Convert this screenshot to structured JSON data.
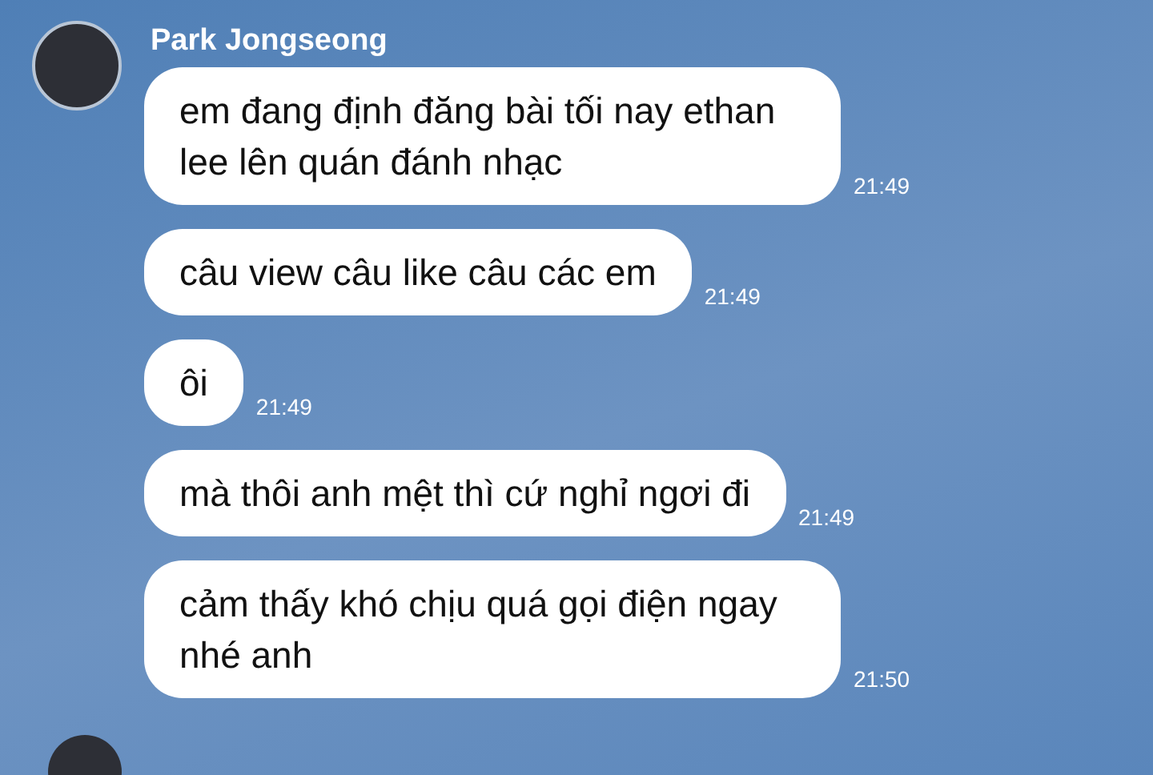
{
  "sender": {
    "name": "Park Jongseong"
  },
  "messages": [
    {
      "text": "em đang định đăng bài tối nay ethan lee lên quán đánh nhạc",
      "time": "21:49"
    },
    {
      "text": "câu view câu like câu các em",
      "time": "21:49"
    },
    {
      "text": "ôi",
      "time": "21:49"
    },
    {
      "text": "mà thôi anh mệt thì cứ nghỉ ngơi đi",
      "time": "21:49"
    },
    {
      "text": "cảm thấy khó chịu quá gọi điện ngay nhé anh",
      "time": "21:50"
    }
  ]
}
